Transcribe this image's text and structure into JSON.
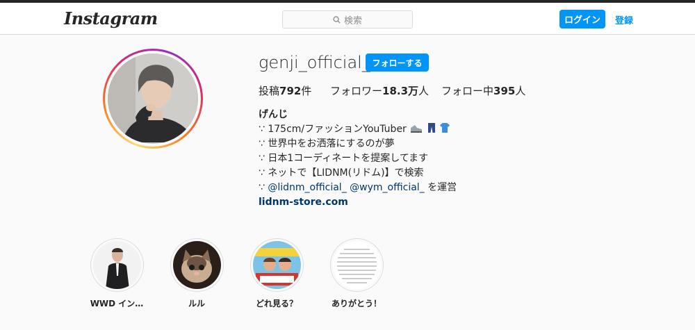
{
  "header": {
    "logo": "Instagram",
    "search_placeholder": "検索",
    "login_label": "ログイン",
    "signup_label": "登録"
  },
  "profile": {
    "username": "genji_official_",
    "follow_label": "フォローする",
    "stats": {
      "posts_label": "投稿",
      "posts_value": "792",
      "posts_unit": "件",
      "followers_label": "フォロワー",
      "followers_value": "18.3万",
      "followers_unit": "人",
      "following_label": "フォロー中",
      "following_value": "395",
      "following_unit": "人"
    },
    "bio": {
      "name": "げんじ",
      "line1": "∵ 175cm/ファッションYouTuber",
      "line2": "∵ 世界中をお洒落にするのが夢",
      "line3": "∵ 日本1コーディネートを提案してます",
      "line4": "∵ ネットで【LIDNM(リドム)】で検索",
      "line5_prefix": "∵ ",
      "mention1": "@lidnm_official_",
      "mention2": "@wym_official_",
      "line5_suffix": " を運営",
      "link": "lidnm-store.com"
    }
  },
  "highlights": [
    {
      "label": "WWD イン…"
    },
    {
      "label": "ルル"
    },
    {
      "label": "どれ見る？"
    },
    {
      "label": "ありがとう！"
    }
  ],
  "colors": {
    "accent": "#0095f6",
    "link": "#00376b",
    "text": "#262626",
    "muted": "#8e8e8e",
    "border": "#dbdbdb",
    "background": "#fafafa"
  }
}
